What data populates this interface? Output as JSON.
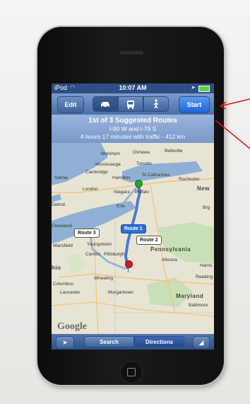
{
  "status_bar": {
    "carrier": "iPod",
    "time": "10:07 AM",
    "wifi_icon": "wifi-icon",
    "battery_icon": "battery-icon"
  },
  "toolbar": {
    "edit_label": "Edit",
    "start_label": "Start",
    "modes": [
      "car-icon",
      "bus-icon",
      "walk-icon"
    ],
    "selected_mode": "car-icon"
  },
  "route_banner": {
    "title": "1st of 3 Suggested Routes",
    "roads": "I-90 W and I-79 S",
    "summary": "4 hours 17 minutes with traffic - 412 km"
  },
  "map": {
    "labels": {
      "markham": "Markham",
      "oshawa": "Oshawa",
      "belleville": "Belleville",
      "mississauga": "Mississauga",
      "toronto": "Toronto",
      "cambridge": "Cambridge",
      "hamilton": "Hamilton",
      "st_catharines": "St Catharines",
      "rochester": "Rochester",
      "new": "New",
      "sarnia": "Sarnia",
      "london": "London",
      "niagara": "Niagara",
      "buffalo": "Buffalo",
      "detroit": "Detroit",
      "erie": "Erie",
      "brg": "Brg",
      "cleveland": "Cleveland",
      "mansfield": "Mansfield",
      "youngstown": "Youngstown",
      "pittsburgh": "Pittsburgh",
      "canton": "Canton",
      "pennsylvania": "Pennsylvania",
      "altoona": "Altoona",
      "harris": "Harris",
      "reading": "Reading",
      "ohio": "hio",
      "columbus": "Columbus",
      "lancaster": "Lancaster",
      "morgantown": "Morgantown",
      "wheeling": "Wheeling",
      "maryland": "Maryland",
      "baltimore": "Baltimore"
    },
    "routes": [
      {
        "label": "Route 1",
        "active": true
      },
      {
        "label": "Route 2",
        "active": false
      },
      {
        "label": "Route 3",
        "active": false
      }
    ],
    "watermark": "Google",
    "start_pin_icon": "green-pin-icon",
    "end_pin_icon": "red-pin-icon"
  },
  "bottom_bar": {
    "location_icon": "location-arrow-icon",
    "tabs": [
      "Search",
      "Directions"
    ],
    "selected_tab": "Directions",
    "page_curl_icon": "page-curl-icon"
  },
  "colors": {
    "toolbar": "#486fa8",
    "start_button": "#1f63d6",
    "route_active": "#2b6fd6",
    "route_line": "#5a86d8",
    "annotation_arrow": "#e11111"
  }
}
